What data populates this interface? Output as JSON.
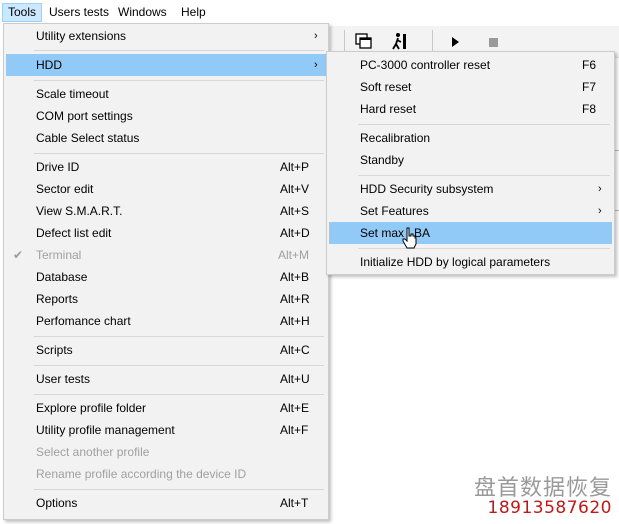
{
  "menubar": {
    "items": [
      "Tools",
      "Users tests",
      "Windows",
      "Help"
    ]
  },
  "tools_menu": {
    "items": [
      {
        "label": "Utility extensions",
        "shortcut": "",
        "submenu": true
      },
      {
        "label": "HDD",
        "shortcut": "",
        "submenu": true
      },
      {
        "label": "Scale timeout",
        "shortcut": ""
      },
      {
        "label": "COM port settings",
        "shortcut": ""
      },
      {
        "label": "Cable Select status",
        "shortcut": ""
      },
      {
        "label": "Drive ID",
        "shortcut": "Alt+P"
      },
      {
        "label": "Sector edit",
        "shortcut": "Alt+V"
      },
      {
        "label": "View S.M.A.R.T.",
        "shortcut": "Alt+S"
      },
      {
        "label": "Defect list edit",
        "shortcut": "Alt+D"
      },
      {
        "label": "Terminal",
        "shortcut": "Alt+M"
      },
      {
        "label": "Database",
        "shortcut": "Alt+B"
      },
      {
        "label": "Reports",
        "shortcut": "Alt+R"
      },
      {
        "label": "Perfomance chart",
        "shortcut": "Alt+H"
      },
      {
        "label": "Scripts",
        "shortcut": "Alt+C"
      },
      {
        "label": "User tests",
        "shortcut": "Alt+U"
      },
      {
        "label": "Explore profile folder",
        "shortcut": "Alt+E"
      },
      {
        "label": "Utility profile management",
        "shortcut": "Alt+F"
      },
      {
        "label": "Select another profile",
        "shortcut": ""
      },
      {
        "label": "Rename profile according the device ID",
        "shortcut": ""
      },
      {
        "label": "Options",
        "shortcut": "Alt+T"
      }
    ],
    "submenu_arrow": "›",
    "check_mark": "✔"
  },
  "hdd_submenu": {
    "items": [
      {
        "label": "PC-3000 controller reset",
        "shortcut": "F6"
      },
      {
        "label": "Soft reset",
        "shortcut": "F7"
      },
      {
        "label": "Hard reset",
        "shortcut": "F8"
      },
      {
        "label": "Recalibration",
        "shortcut": ""
      },
      {
        "label": "Standby",
        "shortcut": ""
      },
      {
        "label": "HDD Security subsystem",
        "shortcut": ""
      },
      {
        "label": "Set Features",
        "shortcut": ""
      },
      {
        "label": "Set max LBA",
        "shortcut": ""
      },
      {
        "label": "Initialize HDD by logical parameters",
        "shortcut": ""
      }
    ]
  },
  "watermark": {
    "title": "盘首数据恢复",
    "phone": "18913587620"
  },
  "colors": {
    "menu_bg": "#f2f2f2",
    "highlight": "#91c9f7",
    "menubar_active": "#cce8ff",
    "disabled_text": "#a0a0a0",
    "phone_red": "#c01818"
  }
}
